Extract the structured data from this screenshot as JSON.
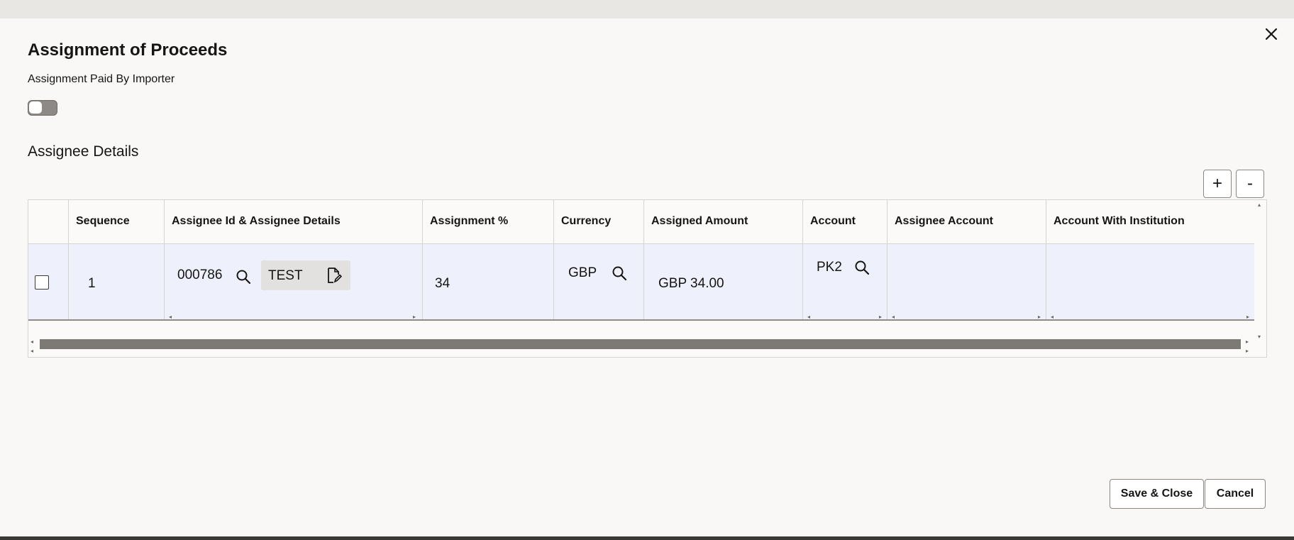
{
  "dialog": {
    "title": "Assignment of Proceeds",
    "close_icon": "close-icon",
    "toggle_label": "Assignment Paid By Importer",
    "toggle_on": false,
    "section_title": "Assignee Details",
    "add_label": "+",
    "remove_label": "-"
  },
  "table": {
    "headers": [
      "Sequence",
      "Assignee Id & Assignee Details",
      "Assignment %",
      "Currency",
      "Assigned Amount",
      "Account",
      "Assignee Account",
      "Account With Institution"
    ],
    "rows": [
      {
        "selected": false,
        "sequence": "1",
        "assignee_id": "000786",
        "assignee_details": "TEST",
        "assignment_pct": "34",
        "currency": "GBP",
        "assigned_amount": "GBP 34.00",
        "account": "PK2",
        "assignee_account": "",
        "account_with_institution": ""
      }
    ]
  },
  "footer": {
    "save_label": "Save & Close",
    "cancel_label": "Cancel"
  },
  "icons": [
    "close-icon",
    "search-icon",
    "edit-document-icon",
    "plus-icon",
    "minus-icon"
  ],
  "colors": {
    "dialog_background": "#f9f8f6",
    "row_background": "#eef1fb",
    "scrollbar_thumb": "#7d7a76",
    "toggle_track": "#8c8986"
  }
}
